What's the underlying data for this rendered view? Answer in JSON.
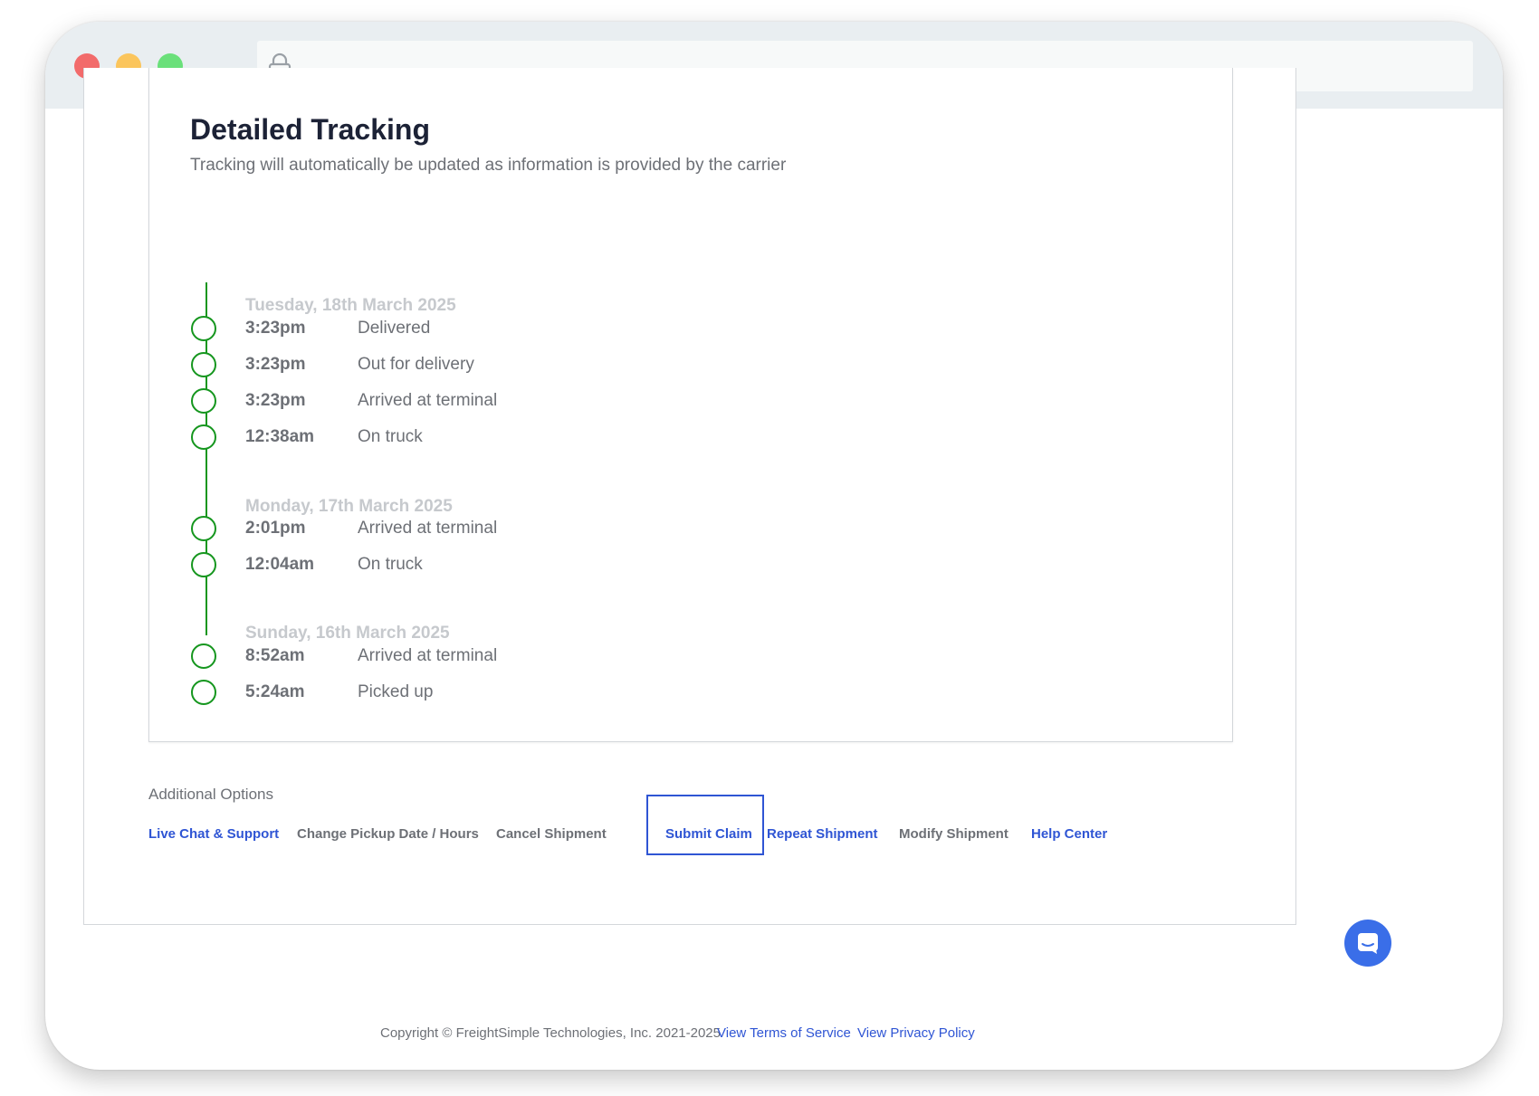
{
  "tracking": {
    "title": "Detailed Tracking",
    "subtitle": "Tracking will automatically be updated as information is provided by the carrier",
    "days": [
      {
        "date": "Tuesday, 18th March 2025",
        "events": [
          {
            "time": "3:23pm",
            "description": "Delivered"
          },
          {
            "time": "3:23pm",
            "description": "Out for delivery"
          },
          {
            "time": "3:23pm",
            "description": "Arrived at terminal"
          },
          {
            "time": "12:38am",
            "description": "On truck"
          }
        ]
      },
      {
        "date": "Monday, 17th March 2025",
        "events": [
          {
            "time": "2:01pm",
            "description": "Arrived at terminal"
          },
          {
            "time": "12:04am",
            "description": "On truck"
          }
        ]
      },
      {
        "date": "Sunday, 16th March 2025",
        "events": [
          {
            "time": "8:52am",
            "description": "Arrived at terminal"
          },
          {
            "time": "5:24am",
            "description": "Picked up"
          }
        ]
      }
    ]
  },
  "additional_options": {
    "label": "Additional Options",
    "items": [
      {
        "label": "Live Chat & Support"
      },
      {
        "label": "Change Pickup Date / Hours"
      },
      {
        "label": "Cancel Shipment"
      },
      {
        "label": "Submit Claim"
      },
      {
        "label": "Repeat Shipment"
      },
      {
        "label": "Modify Shipment"
      },
      {
        "label": "Help Center"
      }
    ]
  },
  "footer": {
    "copyright": "Copyright © FreightSimple Technologies, Inc. 2021-2025",
    "terms_link": "View Terms of Service",
    "privacy_link": "View Privacy Policy"
  },
  "colors": {
    "accent_blue": "#2f55d4",
    "timeline_green": "#15961e",
    "chat_button": "#3a6ee8"
  },
  "icons": {
    "url_bar": "lock-icon",
    "chat": "chat-icon"
  }
}
